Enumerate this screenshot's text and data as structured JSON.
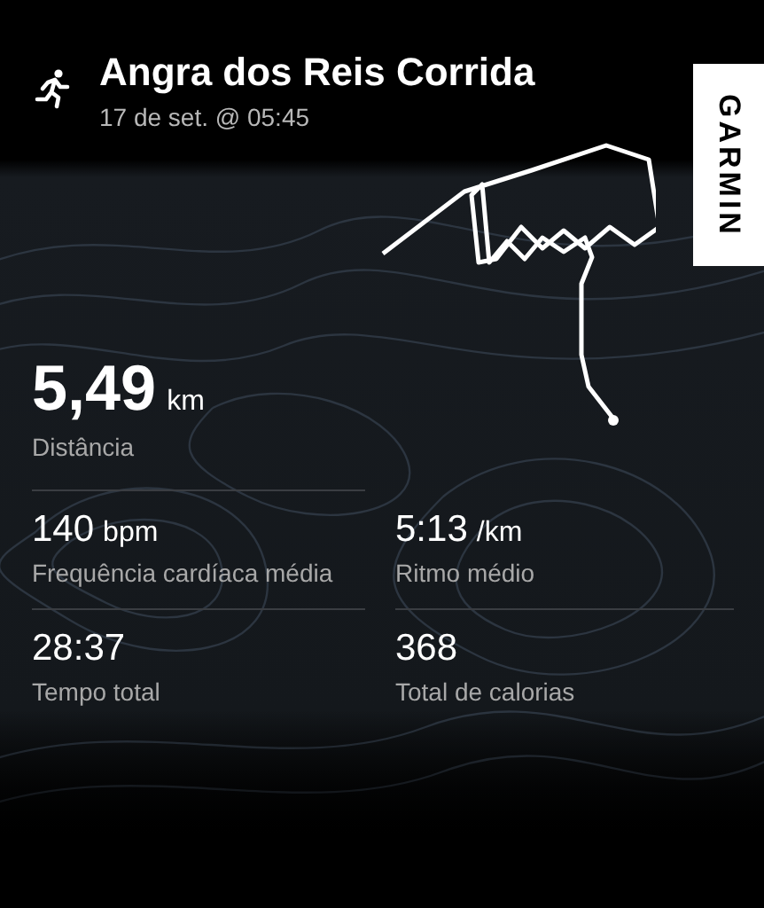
{
  "activity": {
    "title": "Angra dos Reis Corrida",
    "date": "17 de set. @ 05:45"
  },
  "brand": {
    "logo": "GARMIN"
  },
  "main_stat": {
    "value": "5,49",
    "unit": "km",
    "label": "Distância"
  },
  "stats": [
    {
      "value": "140",
      "unit": "bpm",
      "label": "Frequência cardíaca média"
    },
    {
      "value": "5:13",
      "unit": "/km",
      "label": "Ritmo médio"
    },
    {
      "value": "28:37",
      "label": "Tempo total"
    },
    {
      "value": "368",
      "label": "Total de calorias"
    }
  ]
}
